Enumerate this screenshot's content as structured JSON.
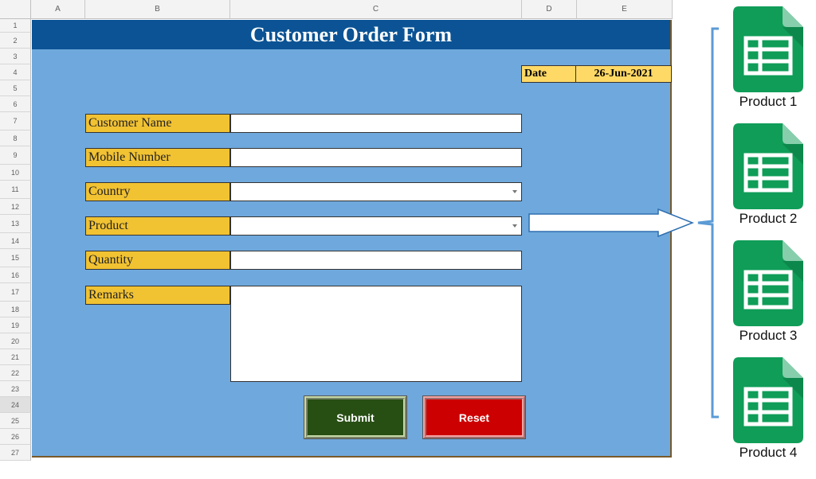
{
  "spreadsheet": {
    "columns": [
      "A",
      "B",
      "C",
      "D",
      "E"
    ],
    "rows": [
      "1",
      "2",
      "3",
      "4",
      "5",
      "6",
      "7",
      "8",
      "9",
      "10",
      "11",
      "12",
      "13",
      "14",
      "15",
      "16",
      "17",
      "18",
      "19",
      "20",
      "21",
      "22",
      "23",
      "24",
      "25",
      "26",
      "27"
    ],
    "selected_row": "24"
  },
  "form": {
    "title": "Customer Order Form",
    "date_label": "Date",
    "date_value": "26-Jun-2021",
    "fields": {
      "customer_name": {
        "label": "Customer Name",
        "value": ""
      },
      "mobile_number": {
        "label": "Mobile Number",
        "value": ""
      },
      "country": {
        "label": "Country",
        "value": ""
      },
      "product": {
        "label": "Product",
        "value": ""
      },
      "quantity": {
        "label": "Quantity",
        "value": ""
      },
      "remarks": {
        "label": "Remarks",
        "value": ""
      }
    },
    "buttons": {
      "submit": "Submit",
      "reset": "Reset"
    }
  },
  "products": [
    {
      "label": "Product  1",
      "icon": "google-sheets-icon"
    },
    {
      "label": "Product  2",
      "icon": "google-sheets-icon"
    },
    {
      "label": "Product  3",
      "icon": "google-sheets-icon"
    },
    {
      "label": "Product  4",
      "icon": "google-sheets-icon"
    }
  ],
  "colors": {
    "title_bar": "#0b5394",
    "form_background": "#6fa8dc",
    "label_fill": "#f1c232",
    "date_fill": "#ffd966",
    "submit": "#274e13",
    "reset": "#cc0000",
    "sheets_green": "#0f9d58"
  }
}
